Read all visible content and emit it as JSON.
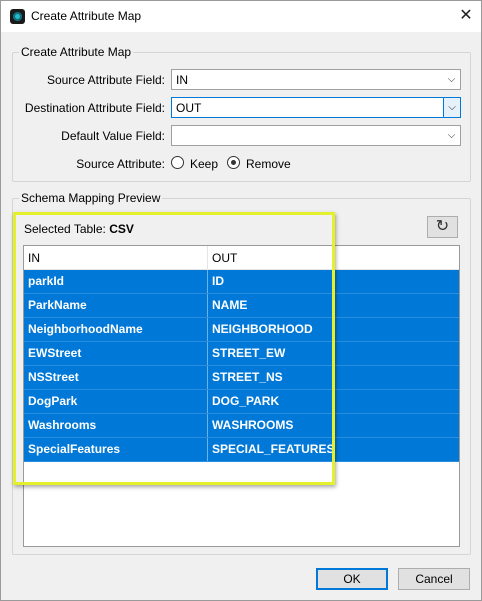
{
  "window": {
    "title": "Create Attribute Map",
    "close_glyph": "✕",
    "icon": "app-icon"
  },
  "form_group": {
    "legend": "Create Attribute Map",
    "source_field": {
      "label": "Source Attribute Field:",
      "value": "IN"
    },
    "destination_field": {
      "label": "Destination Attribute Field:",
      "value": "OUT"
    },
    "default_value_field": {
      "label": "Default Value Field:",
      "value": ""
    },
    "source_attribute": {
      "label": "Source Attribute:",
      "options": [
        {
          "label": "Keep",
          "selected": false
        },
        {
          "label": "Remove",
          "selected": true
        }
      ]
    }
  },
  "preview_group": {
    "legend": "Schema Mapping Preview",
    "selected_table_label": "Selected Table:",
    "selected_table_value": "CSV",
    "refresh_icon": "refresh-icon",
    "refresh_glyph": "↻",
    "columns": [
      "IN",
      "OUT"
    ],
    "rows": [
      [
        "parkId",
        "ID"
      ],
      [
        "ParkName",
        "NAME"
      ],
      [
        "NeighborhoodName",
        "NEIGHBORHOOD"
      ],
      [
        "EWStreet",
        "STREET_EW"
      ],
      [
        "NSStreet",
        "STREET_NS"
      ],
      [
        "DogPark",
        "DOG_PARK"
      ],
      [
        "Washrooms",
        "WASHROOMS"
      ],
      [
        "SpecialFeatures",
        "SPECIAL_FEATURES"
      ]
    ]
  },
  "buttons": {
    "ok": "OK",
    "cancel": "Cancel"
  },
  "chevron_glyph": "⌵",
  "colors": {
    "selection": "#0078d7",
    "highlight_box": "#e4f02c",
    "focus_border": "#0078d7"
  }
}
